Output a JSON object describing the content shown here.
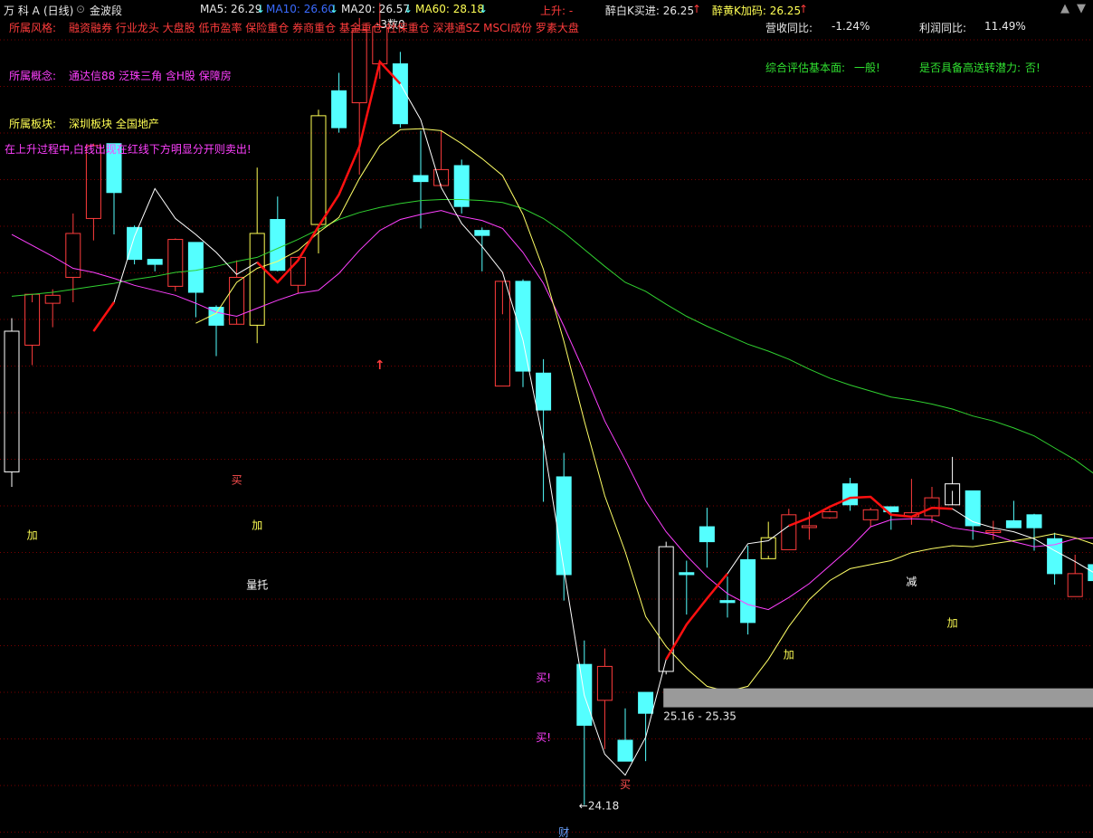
{
  "header": {
    "stock_name": "万 科 A",
    "period": "(日线)",
    "indicator_name": "金波段",
    "ma5": "MA5: 26.29",
    "ma10": "MA10: 26.60",
    "ma20": "MA20: 26.57",
    "ma60": "MA60: 28.18",
    "up_label": "上升: -",
    "zuibai_label": "醉白K买进: 26.25",
    "zuihuang_label": "醉黄K加码: 26.25",
    "arrow_down": "↓",
    "arrow_up": "↑",
    "center_mark": "-3数0"
  },
  "info": {
    "style_label": "所属风格:",
    "style_value": "融资融券 行业龙头 大盘股 低市盈率 保险重仓 券商重仓 基金重仓 社保重仓 深港通SZ MSCI成份 罗素大盘",
    "concept_label": "所属概念:",
    "concept_value": "通达信88 泛珠三角 含H股 保障房",
    "sector_label": "所属板块:",
    "sector_value": "深圳板块 全国地产",
    "note": "在上升过程中,白线出现在红线下方明显分开则卖出!",
    "revenue_label": "营收同比:",
    "revenue_value": "-1.24%",
    "profit_label": "利润同比:",
    "profit_value": "11.49%",
    "eval_label": "综合评估基本面:",
    "eval_value": "一般!",
    "transfer_label": "是否具备高送转潜力:",
    "transfer_value": "否!"
  },
  "colors": {
    "up": "#ff3c3c",
    "down": "#54ffff",
    "yellow_candle": "#ffff54",
    "white_candle": "#ffffff",
    "ma5": "#ffffff",
    "ma10": "#ffff66",
    "ma20": "#ff40ff",
    "ma60": "#30d030",
    "trend": "#ff1010",
    "grid": "#7a0000",
    "zone": "#9a9a9a"
  },
  "chart_data": {
    "type": "candlestick",
    "ylim": [
      23.85,
      32.25
    ],
    "candles": [
      {
        "o": 28.93,
        "h": 29.06,
        "l": 27.37,
        "c": 27.52,
        "style": "white"
      },
      {
        "o": 28.79,
        "h": 29.22,
        "l": 28.59,
        "c": 29.3,
        "style": "up"
      },
      {
        "o": 29.21,
        "h": 29.35,
        "l": 28.97,
        "c": 29.29,
        "style": "up"
      },
      {
        "o": 29.47,
        "h": 30.11,
        "l": 29.22,
        "c": 29.91,
        "style": "up"
      },
      {
        "o": 30.06,
        "h": 30.81,
        "l": 29.84,
        "c": 30.79,
        "style": "up"
      },
      {
        "o": 30.81,
        "h": 30.77,
        "l": 29.9,
        "c": 30.32,
        "style": "down"
      },
      {
        "o": 29.97,
        "h": 29.99,
        "l": 29.6,
        "c": 29.65,
        "style": "down"
      },
      {
        "o": 29.65,
        "h": 29.63,
        "l": 29.53,
        "c": 29.6,
        "style": "down"
      },
      {
        "o": 29.38,
        "h": 29.86,
        "l": 29.33,
        "c": 29.85,
        "style": "up"
      },
      {
        "o": 29.82,
        "h": 29.82,
        "l": 29.07,
        "c": 29.32,
        "style": "down"
      },
      {
        "o": 29.17,
        "h": 29.19,
        "l": 28.68,
        "c": 28.99,
        "style": "down"
      },
      {
        "o": 29.0,
        "h": 29.64,
        "l": 29.06,
        "c": 29.47,
        "style": "up"
      },
      {
        "o": 28.99,
        "h": 30.57,
        "l": 28.81,
        "c": 29.91,
        "style": "yellow"
      },
      {
        "o": 30.05,
        "h": 30.28,
        "l": 29.53,
        "c": 29.54,
        "style": "down"
      },
      {
        "o": 29.39,
        "h": 29.68,
        "l": 29.31,
        "c": 29.67,
        "style": "up"
      },
      {
        "o": 30.0,
        "h": 31.15,
        "l": 29.71,
        "c": 31.09,
        "style": "yellow"
      },
      {
        "o": 31.34,
        "h": 31.52,
        "l": 30.92,
        "c": 30.97,
        "style": "down"
      },
      {
        "o": 31.22,
        "h": 32.07,
        "l": 30.5,
        "c": 31.95,
        "style": "up"
      },
      {
        "o": 31.61,
        "h": 32.22,
        "l": 31.46,
        "c": 31.98,
        "style": "up"
      },
      {
        "o": 31.61,
        "h": 31.73,
        "l": 30.97,
        "c": 31.01,
        "style": "down"
      },
      {
        "o": 30.49,
        "h": 30.94,
        "l": 29.96,
        "c": 30.43,
        "style": "down"
      },
      {
        "o": 30.39,
        "h": 30.94,
        "l": 30.41,
        "c": 30.55,
        "style": "up"
      },
      {
        "o": 30.59,
        "h": 30.65,
        "l": 30.11,
        "c": 30.18,
        "style": "down"
      },
      {
        "o": 29.94,
        "h": 29.97,
        "l": 29.53,
        "c": 29.89,
        "style": "down"
      },
      {
        "o": 28.38,
        "h": 29.1,
        "l": 28.38,
        "c": 29.43,
        "style": "up"
      },
      {
        "o": 29.43,
        "h": 29.45,
        "l": 28.37,
        "c": 28.53,
        "style": "down"
      },
      {
        "o": 28.51,
        "h": 28.65,
        "l": 27.22,
        "c": 28.14,
        "style": "down"
      },
      {
        "o": 27.47,
        "h": 27.71,
        "l": 26.23,
        "c": 26.49,
        "style": "down"
      },
      {
        "o": 25.59,
        "h": 25.83,
        "l": 24.18,
        "c": 24.98,
        "style": "down"
      },
      {
        "o": 25.23,
        "h": 25.75,
        "l": 24.74,
        "c": 25.57,
        "style": "up"
      },
      {
        "o": 24.83,
        "h": 25.15,
        "l": 24.65,
        "c": 24.62,
        "style": "down"
      },
      {
        "o": 25.1,
        "h": 25.18,
        "l": 24.62,
        "c": 25.31,
        "style": "down"
      },
      {
        "o": 26.77,
        "h": 26.82,
        "l": 25.49,
        "c": 25.52,
        "style": "white"
      },
      {
        "o": 26.51,
        "h": 26.63,
        "l": 26.09,
        "c": 26.49,
        "style": "down"
      },
      {
        "o": 26.97,
        "h": 27.16,
        "l": 26.56,
        "c": 26.82,
        "style": "down"
      },
      {
        "o": 26.23,
        "h": 26.47,
        "l": 26.06,
        "c": 26.21,
        "style": "down"
      },
      {
        "o": 26.64,
        "h": 26.78,
        "l": 25.89,
        "c": 26.01,
        "style": "down"
      },
      {
        "o": 26.65,
        "h": 27.02,
        "l": 26.68,
        "c": 26.86,
        "style": "yellow"
      },
      {
        "o": 26.74,
        "h": 27.15,
        "l": 26.74,
        "c": 27.09,
        "style": "up"
      },
      {
        "o": 26.97,
        "h": 27.12,
        "l": 26.84,
        "c": 26.98,
        "style": "up"
      },
      {
        "o": 27.06,
        "h": 27.15,
        "l": 27.05,
        "c": 27.12,
        "style": "up"
      },
      {
        "o": 27.4,
        "h": 27.46,
        "l": 27.13,
        "c": 27.19,
        "style": "down"
      },
      {
        "o": 27.14,
        "h": 27.16,
        "l": 26.97,
        "c": 27.04,
        "style": "up"
      },
      {
        "o": 27.12,
        "h": 27.15,
        "l": 26.94,
        "c": 27.17,
        "style": "down"
      },
      {
        "o": 27.07,
        "h": 27.45,
        "l": 26.99,
        "c": 27.11,
        "style": "up"
      },
      {
        "o": 27.08,
        "h": 27.37,
        "l": 27.01,
        "c": 27.26,
        "style": "up"
      },
      {
        "o": 27.4,
        "h": 27.67,
        "l": 27.33,
        "c": 27.19,
        "style": "white"
      },
      {
        "o": 27.33,
        "h": 27.26,
        "l": 26.84,
        "c": 26.98,
        "style": "down"
      },
      {
        "o": 26.93,
        "h": 27.03,
        "l": 26.84,
        "c": 26.92,
        "style": "up"
      },
      {
        "o": 27.03,
        "h": 27.23,
        "l": 27.01,
        "c": 26.96,
        "style": "down"
      },
      {
        "o": 27.09,
        "h": 27.1,
        "l": 26.73,
        "c": 26.96,
        "style": "down"
      },
      {
        "o": 26.85,
        "h": 26.91,
        "l": 26.39,
        "c": 26.5,
        "style": "down"
      },
      {
        "o": 26.27,
        "h": 26.69,
        "l": 26.27,
        "c": 26.5,
        "style": "up"
      },
      {
        "o": 26.59,
        "h": 26.61,
        "l": 26.41,
        "c": 26.43,
        "style": "down"
      }
    ],
    "ma5": [
      null,
      null,
      null,
      null,
      28.93,
      29.22,
      29.88,
      30.36,
      30.06,
      29.9,
      29.72,
      29.5,
      29.62,
      29.42,
      29.64,
      29.98,
      30.3,
      30.78,
      31.63,
      31.41,
      31.05,
      30.37,
      30.01,
      29.78,
      29.52,
      28.84,
      27.82,
      26.55,
      25.28,
      24.69,
      24.48,
      24.86,
      25.64,
      25.99,
      26.25,
      26.5,
      26.8,
      26.83,
      26.98,
      27.06,
      27.17,
      27.26,
      27.27,
      27.09,
      27.07,
      27.16,
      27.15,
      27.02,
      26.96,
      26.92,
      26.85,
      26.73,
      26.62,
      26.5
    ],
    "ma10": [
      null,
      null,
      null,
      null,
      null,
      null,
      null,
      null,
      null,
      29.01,
      29.11,
      29.42,
      29.56,
      29.63,
      29.74,
      29.92,
      30.07,
      30.46,
      30.79,
      30.95,
      30.96,
      30.94,
      30.81,
      30.66,
      30.49,
      30.1,
      29.55,
      28.83,
      28.03,
      27.28,
      26.72,
      26.07,
      25.77,
      25.55,
      25.37,
      25.32,
      25.37,
      25.64,
      25.97,
      26.24,
      26.43,
      26.55,
      26.59,
      26.63,
      26.71,
      26.75,
      26.78,
      26.77,
      26.8,
      26.83,
      26.86,
      26.9,
      26.86,
      26.79
    ],
    "ma20": [
      29.9,
      29.79,
      29.68,
      29.56,
      29.52,
      29.46,
      29.39,
      29.34,
      29.29,
      29.21,
      29.12,
      29.08,
      29.16,
      29.24,
      29.31,
      29.34,
      29.51,
      29.74,
      29.94,
      30.05,
      30.1,
      30.14,
      30.08,
      30.04,
      29.96,
      29.72,
      29.41,
      28.98,
      28.52,
      28.03,
      27.64,
      27.23,
      26.92,
      26.68,
      26.47,
      26.3,
      26.19,
      26.14,
      26.26,
      26.4,
      26.58,
      26.76,
      26.97,
      27.04,
      27.05,
      27.04,
      26.96,
      26.93,
      26.89,
      26.82,
      26.77,
      26.79,
      26.85,
      26.86
    ],
    "ma60": [
      29.28,
      29.3,
      29.32,
      29.35,
      29.38,
      29.41,
      29.45,
      29.48,
      29.52,
      29.54,
      29.58,
      29.63,
      29.67,
      29.76,
      29.85,
      29.95,
      30.05,
      30.12,
      30.17,
      30.21,
      30.24,
      30.25,
      30.25,
      30.24,
      30.22,
      30.16,
      30.06,
      29.92,
      29.75,
      29.58,
      29.42,
      29.33,
      29.2,
      29.08,
      28.98,
      28.89,
      28.8,
      28.73,
      28.65,
      28.55,
      28.46,
      28.39,
      28.33,
      28.27,
      28.24,
      28.2,
      28.15,
      28.08,
      28.03,
      27.96,
      27.88,
      27.76,
      27.64,
      27.49
    ],
    "trend_segments": [
      {
        "from": 0,
        "to": 5
      },
      {
        "from": 12,
        "to": 19
      },
      {
        "from": 32,
        "to": 35
      },
      {
        "from": 38,
        "to": 46
      }
    ],
    "annotations": [
      {
        "i": 1,
        "p": 26.85,
        "text": "加",
        "color": "#ffff54"
      },
      {
        "i": 11,
        "p": 27.4,
        "text": "买",
        "color": "#ff5050"
      },
      {
        "i": 12,
        "p": 26.95,
        "text": "加",
        "color": "#ffff54"
      },
      {
        "i": 12,
        "p": 26.35,
        "text": "量托",
        "color": "#ffffff"
      },
      {
        "i": 26,
        "p": 25.42,
        "text": "买!",
        "color": "#ff40ff"
      },
      {
        "i": 26,
        "p": 24.82,
        "text": "买!",
        "color": "#ff40ff"
      },
      {
        "i": 30,
        "p": 24.35,
        "text": "买",
        "color": "#ff5050"
      },
      {
        "i": 38,
        "p": 25.65,
        "text": "加",
        "color": "#ffff54"
      },
      {
        "i": 44,
        "p": 26.38,
        "text": "减",
        "color": "#ffffff"
      },
      {
        "i": 46,
        "p": 25.97,
        "text": "加",
        "color": "#ffff54"
      },
      {
        "i": 27,
        "p": 23.87,
        "text": "财",
        "color": "#6aa2ff"
      }
    ],
    "buy_arrow": {
      "i": 18,
      "p": 28.55,
      "text": "↑"
    },
    "low_label": {
      "i": 28,
      "p": 24.18,
      "text": "←24.18"
    },
    "zone": {
      "from_i": 32,
      "low": 25.16,
      "high": 25.35,
      "label": "25.16 - 25.35"
    }
  }
}
